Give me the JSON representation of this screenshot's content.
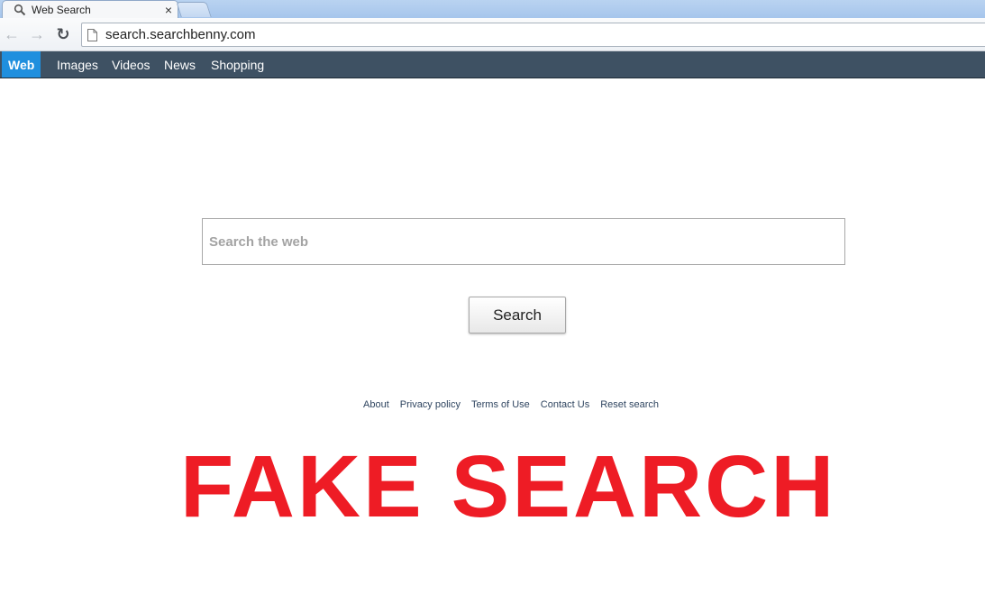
{
  "browser": {
    "tab_title": "Web Search",
    "tab_close": "×",
    "url": "search.searchbenny.com",
    "back_glyph": "←",
    "forward_glyph": "→",
    "reload_glyph": "↻",
    "icons": [
      "search-icon",
      "back-icon",
      "forward-icon",
      "reload-icon",
      "page-icon",
      "close-icon"
    ]
  },
  "nav": {
    "items": [
      {
        "label": "Web",
        "active": true
      },
      {
        "label": "Images",
        "active": false
      },
      {
        "label": "Videos",
        "active": false
      },
      {
        "label": "News",
        "active": false
      },
      {
        "label": "Shopping",
        "active": false
      }
    ],
    "background": "#3e5163",
    "active_color": "#1f8fde"
  },
  "search": {
    "placeholder": "Search the web",
    "value": "",
    "button_label": "Search"
  },
  "footer": {
    "links": [
      "About",
      "Privacy policy",
      "Terms of Use",
      "Contact Us",
      "Reset search"
    ]
  },
  "overlay": {
    "text": "FAKE SEARCH",
    "color": "#ee1c25"
  }
}
